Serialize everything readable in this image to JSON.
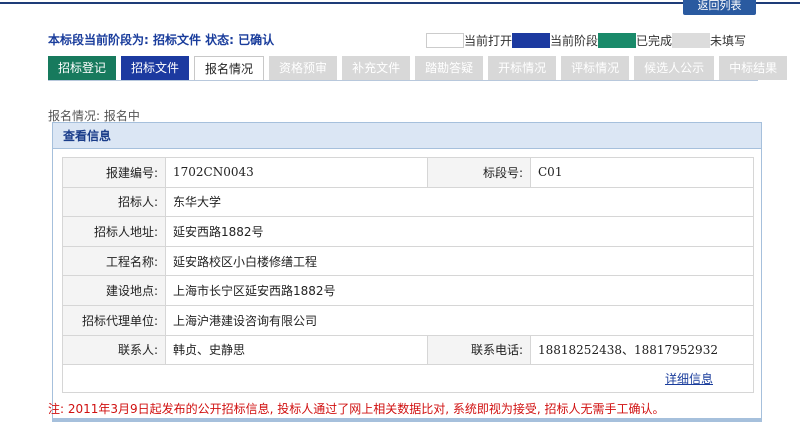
{
  "header": {
    "back_label": "返回列表"
  },
  "stage": {
    "text": "本标段当前阶段为: 招标文件  状态: 已确认"
  },
  "legend": {
    "items": [
      {
        "label": "当前打开",
        "color": "#ffffff"
      },
      {
        "label": "当前阶段",
        "color": "#1c3aa0"
      },
      {
        "label": "已完成",
        "color": "#1a8a6a"
      },
      {
        "label": "未填写",
        "color": "#dcdcdc"
      }
    ]
  },
  "tabs": [
    {
      "label": "招标登记",
      "state": "done"
    },
    {
      "label": "招标文件",
      "state": "current"
    },
    {
      "label": "报名情况",
      "state": "open"
    },
    {
      "label": "资格预审",
      "state": "disabled"
    },
    {
      "label": "补充文件",
      "state": "disabled"
    },
    {
      "label": "踏勘答疑",
      "state": "disabled"
    },
    {
      "label": "开标情况",
      "state": "disabled"
    },
    {
      "label": "评标情况",
      "state": "disabled"
    },
    {
      "label": "候选人公示",
      "state": "disabled"
    },
    {
      "label": "中标结果",
      "state": "disabled"
    }
  ],
  "registration": {
    "status_text": "报名情况: 报名中"
  },
  "panel": {
    "title": "查看信息"
  },
  "info": {
    "project_no_label": "报建编号:",
    "project_no": "1702CN0043",
    "section_no_label": "标段号:",
    "section_no": "C01",
    "tenderer_label": "招标人:",
    "tenderer": "东华大学",
    "tenderer_addr_label": "招标人地址:",
    "tenderer_addr": "延安西路1882号",
    "project_name_label": "工程名称:",
    "project_name": "延安路校区小白楼修缮工程",
    "site_label": "建设地点:",
    "site": "上海市长宁区延安西路1882号",
    "agency_label": "招标代理单位:",
    "agency": "上海沪港建设咨询有限公司",
    "contact_label": "联系人:",
    "contact": "韩贞、史静思",
    "phone_label": "联系电话:",
    "phone": "18818252438、18817952932",
    "detail_link": "详细信息"
  },
  "note": {
    "text": "注: 2011年3月9日起发布的公开招标信息, 投标人通过了网上相关数据比对, 系统即视为接受, 招标人无需手工确认。"
  }
}
